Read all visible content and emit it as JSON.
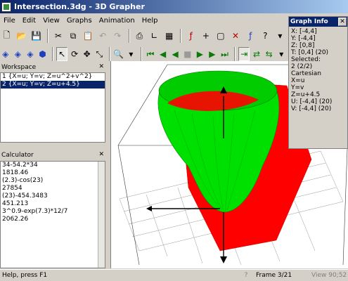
{
  "window": {
    "title": "Intersection.3dg - 3D Grapher"
  },
  "menu": [
    "File",
    "Edit",
    "View",
    "Graphs",
    "Animation",
    "Help"
  ],
  "workspace": {
    "title": "Workspace",
    "items": [
      {
        "label": "1 {X=u; Y=v; Z=u^2+v^2}"
      },
      {
        "label": "2 {X=u; Y=v; Z=u+4.5}"
      }
    ]
  },
  "calculator": {
    "title": "Calculator",
    "lines": [
      "34-54.2*34",
      "1818.46",
      "(2.3)-cos(23)",
      "27854",
      "(23)-454.3483",
      "451.213",
      "3^0.9-exp(7.3)*12/7",
      "2062.26"
    ]
  },
  "graph_info": {
    "title": "Graph Info",
    "lines": [
      "X: [-4,4]",
      "Y: [-4,4]",
      "Z: [0,8]",
      "T: [0,4] (20)",
      "Selected:",
      "2 (2/2)",
      "Cartesian",
      "X=u",
      "Y=v",
      "Z=u+4.5",
      "U: [-4,4] (20)",
      "V: [-4,4] (20)"
    ]
  },
  "status": {
    "help": "Help, press F1",
    "mid": "?",
    "frame": "Frame 3/21",
    "view": "View 90;52"
  },
  "colors": {
    "surface_plane": "#ff0000",
    "surface_paraboloid": "#00e000",
    "title_bar": "#0a246a"
  }
}
